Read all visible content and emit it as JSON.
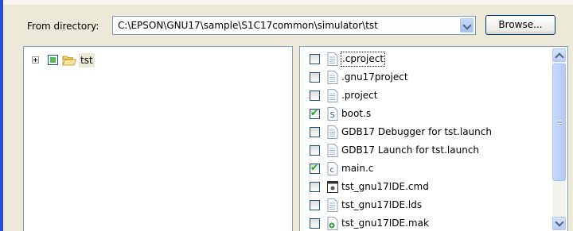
{
  "header": {
    "from_label": "From directory:",
    "directory_value": "C:\\EPSON\\GNU17\\sample\\S1C17common\\simulator\\tst",
    "browse_label": "Browse..."
  },
  "tree": {
    "items": [
      {
        "label": "tst",
        "expanded": false,
        "check_state": "partial"
      }
    ]
  },
  "files": [
    {
      "name": ".cproject",
      "checked": false,
      "icon": "file-icon",
      "focused": true
    },
    {
      "name": ".gnu17project",
      "checked": false,
      "icon": "file-icon"
    },
    {
      "name": ".project",
      "checked": false,
      "icon": "file-icon"
    },
    {
      "name": "boot.s",
      "checked": true,
      "icon": "assembly-file-icon"
    },
    {
      "name": "GDB17 Debugger for tst.launch",
      "checked": false,
      "icon": "file-icon"
    },
    {
      "name": "GDB17 Launch for tst.launch",
      "checked": false,
      "icon": "file-icon"
    },
    {
      "name": "main.c",
      "checked": true,
      "icon": "c-file-icon"
    },
    {
      "name": "tst_gnu17IDE.cmd",
      "checked": false,
      "icon": "command-file-icon"
    },
    {
      "name": "tst_gnu17IDE.lds",
      "checked": false,
      "icon": "file-icon"
    },
    {
      "name": "tst_gnu17IDE.mak",
      "checked": false,
      "icon": "makefile-icon"
    }
  ],
  "colors": {
    "panel_bg": "#ece9d8",
    "left_accent": "#2a4ed3",
    "check_green": "#21a121",
    "border": "#7f9db9"
  }
}
